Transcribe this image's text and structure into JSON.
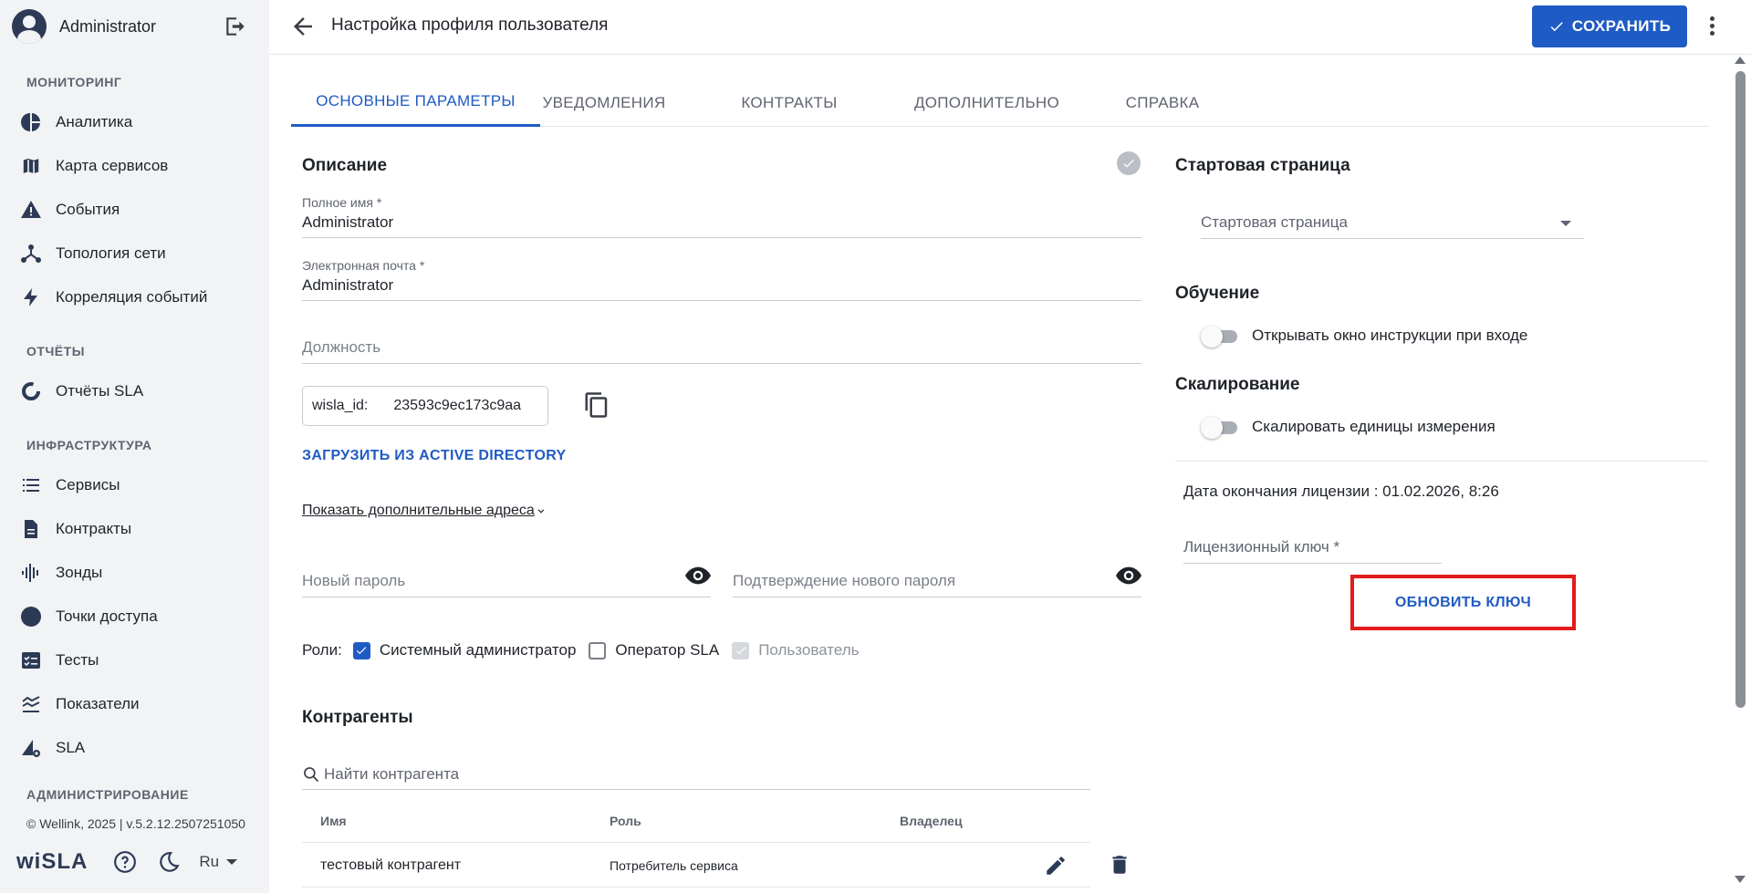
{
  "sidebar": {
    "user": "Administrator",
    "sections": {
      "monitoring": "МОНИТОРИНГ",
      "reports": "ОТЧЁТЫ",
      "infrastructure": "ИНФРАСТРУКТУРА",
      "administration": "АДМИНИСТРИРОВАНИЕ"
    },
    "items": {
      "analytics": "Аналитика",
      "service_map": "Карта сервисов",
      "events": "События",
      "topology": "Топология сети",
      "correlation": "Корреляция событий",
      "sla_reports": "Отчёты SLA",
      "services": "Сервисы",
      "contracts": "Контракты",
      "probes": "Зонды",
      "access_points": "Точки доступа",
      "tests": "Тесты",
      "metrics": "Показатели",
      "sla": "SLA"
    },
    "copyright": "© Wellink, 2025 | v.5.2.12.2507251050",
    "logo": "wiSLA",
    "language": "Ru"
  },
  "header": {
    "title": "Настройка профиля пользователя",
    "save_label": "СОХРАНИТЬ"
  },
  "tabs": [
    "ОСНОВНЫЕ ПАРАМЕТРЫ",
    "УВЕДОМЛЕНИЯ",
    "КОНТРАКТЫ",
    "ДОПОЛНИТЕЛЬНО",
    "СПРАВКА"
  ],
  "form": {
    "description_title": "Описание",
    "full_name_label": "Полное имя *",
    "full_name_value": "Administrator",
    "email_label": "Электронная почта *",
    "email_value": "Administrator",
    "position_placeholder": "Должность",
    "wisla_id_key": "wisla_id:",
    "wisla_id_value": "23593c9ec173c9aa",
    "load_ad_label": "ЗАГРУЗИТЬ ИЗ ACTIVE DIRECTORY",
    "show_more_label": "Показать дополнительные адреса",
    "new_password_placeholder": "Новый пароль",
    "confirm_password_placeholder": "Подтверждение нового пароля",
    "roles_label": "Роли:",
    "roles": [
      {
        "label": "Системный администратор",
        "state": "checked"
      },
      {
        "label": "Оператор SLA",
        "state": "unchecked"
      },
      {
        "label": "Пользователь",
        "state": "disabled-checked"
      }
    ]
  },
  "counterparties": {
    "title": "Контрагенты",
    "search_placeholder": "Найти контрагента",
    "columns": [
      "Имя",
      "Роль",
      "Владелец"
    ],
    "rows": [
      {
        "name": "тестовый контрагент",
        "role": "Потребитель сервиса",
        "owner": ""
      }
    ]
  },
  "right": {
    "start_page_title": "Стартовая страница",
    "start_page_placeholder": "Стартовая страница",
    "training_title": "Обучение",
    "training_toggle": "Открывать окно инструкции при входе",
    "training_on": false,
    "scaling_title": "Скалирование",
    "scaling_toggle": "Скалировать единицы измерения",
    "scaling_on": false,
    "license_date": "Дата окончания лицензии : 01.02.2026, 8:26",
    "license_key_placeholder": "Лицензионный ключ *",
    "refresh_key_label": "ОБНОВИТЬ КЛЮЧ"
  },
  "colors": {
    "accent": "#1f5bc4",
    "highlight": "#e21b1b",
    "sidebar_bg": "#f2f3f5"
  }
}
